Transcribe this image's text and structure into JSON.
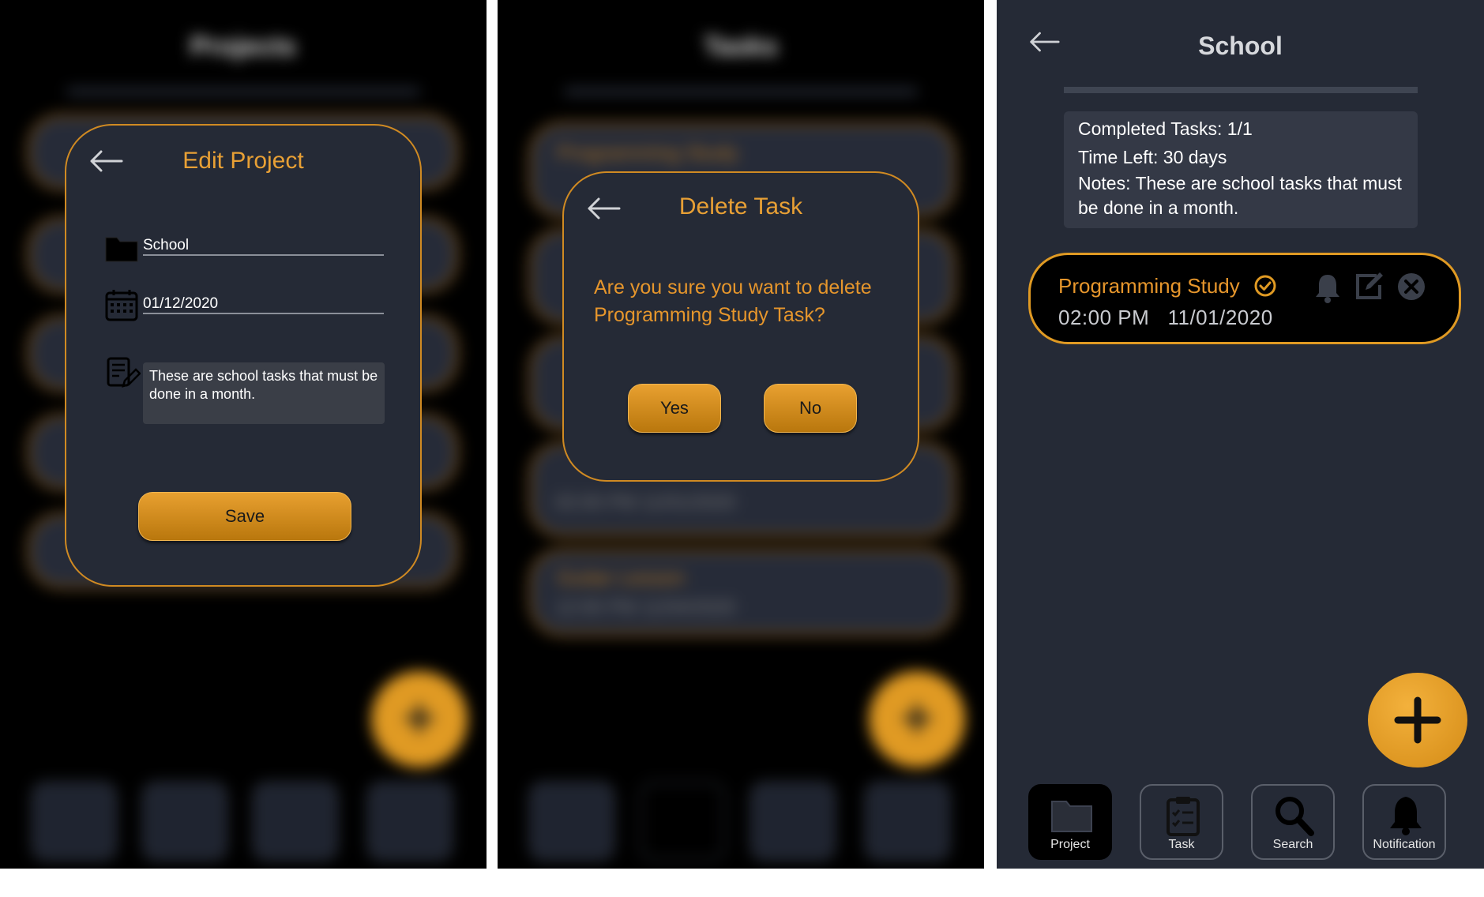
{
  "edit_project": {
    "blurred_title": "Projects",
    "title": "Edit Project",
    "name_value": "School",
    "date_value": "01/12/2020",
    "notes_value": "These are school tasks that must be done in a month.",
    "save_label": "Save"
  },
  "delete_task": {
    "blurred_title": "Tasks",
    "title": "Delete Task",
    "message": "Are you sure you want to delete Programming Study Task?",
    "yes_label": "Yes",
    "no_label": "No",
    "blurred_tasks": [
      {
        "name": "Programming Study",
        "meta": "02:00 PM 11/01/2020"
      },
      {
        "name": "Guitar Lesson",
        "meta": "12:00 PM 11/04/2020"
      }
    ]
  },
  "project_detail": {
    "title": "School",
    "completed": "Completed Tasks: 1/1",
    "time_left": "Time Left: 30 days",
    "notes": "Notes: These are school tasks that must be done in a month.",
    "task": {
      "name": "Programming Study",
      "time": "02:00 PM",
      "date": "11/01/2020"
    },
    "nav": [
      {
        "label": "Project",
        "icon": "folder-icon"
      },
      {
        "label": "Task",
        "icon": "clipboard-icon"
      },
      {
        "label": "Search",
        "icon": "search-icon"
      },
      {
        "label": "Notification",
        "icon": "bell-icon"
      }
    ]
  },
  "colors": {
    "accent": "#e09a23",
    "panel_bg": "#252a36",
    "background": "#000000"
  }
}
